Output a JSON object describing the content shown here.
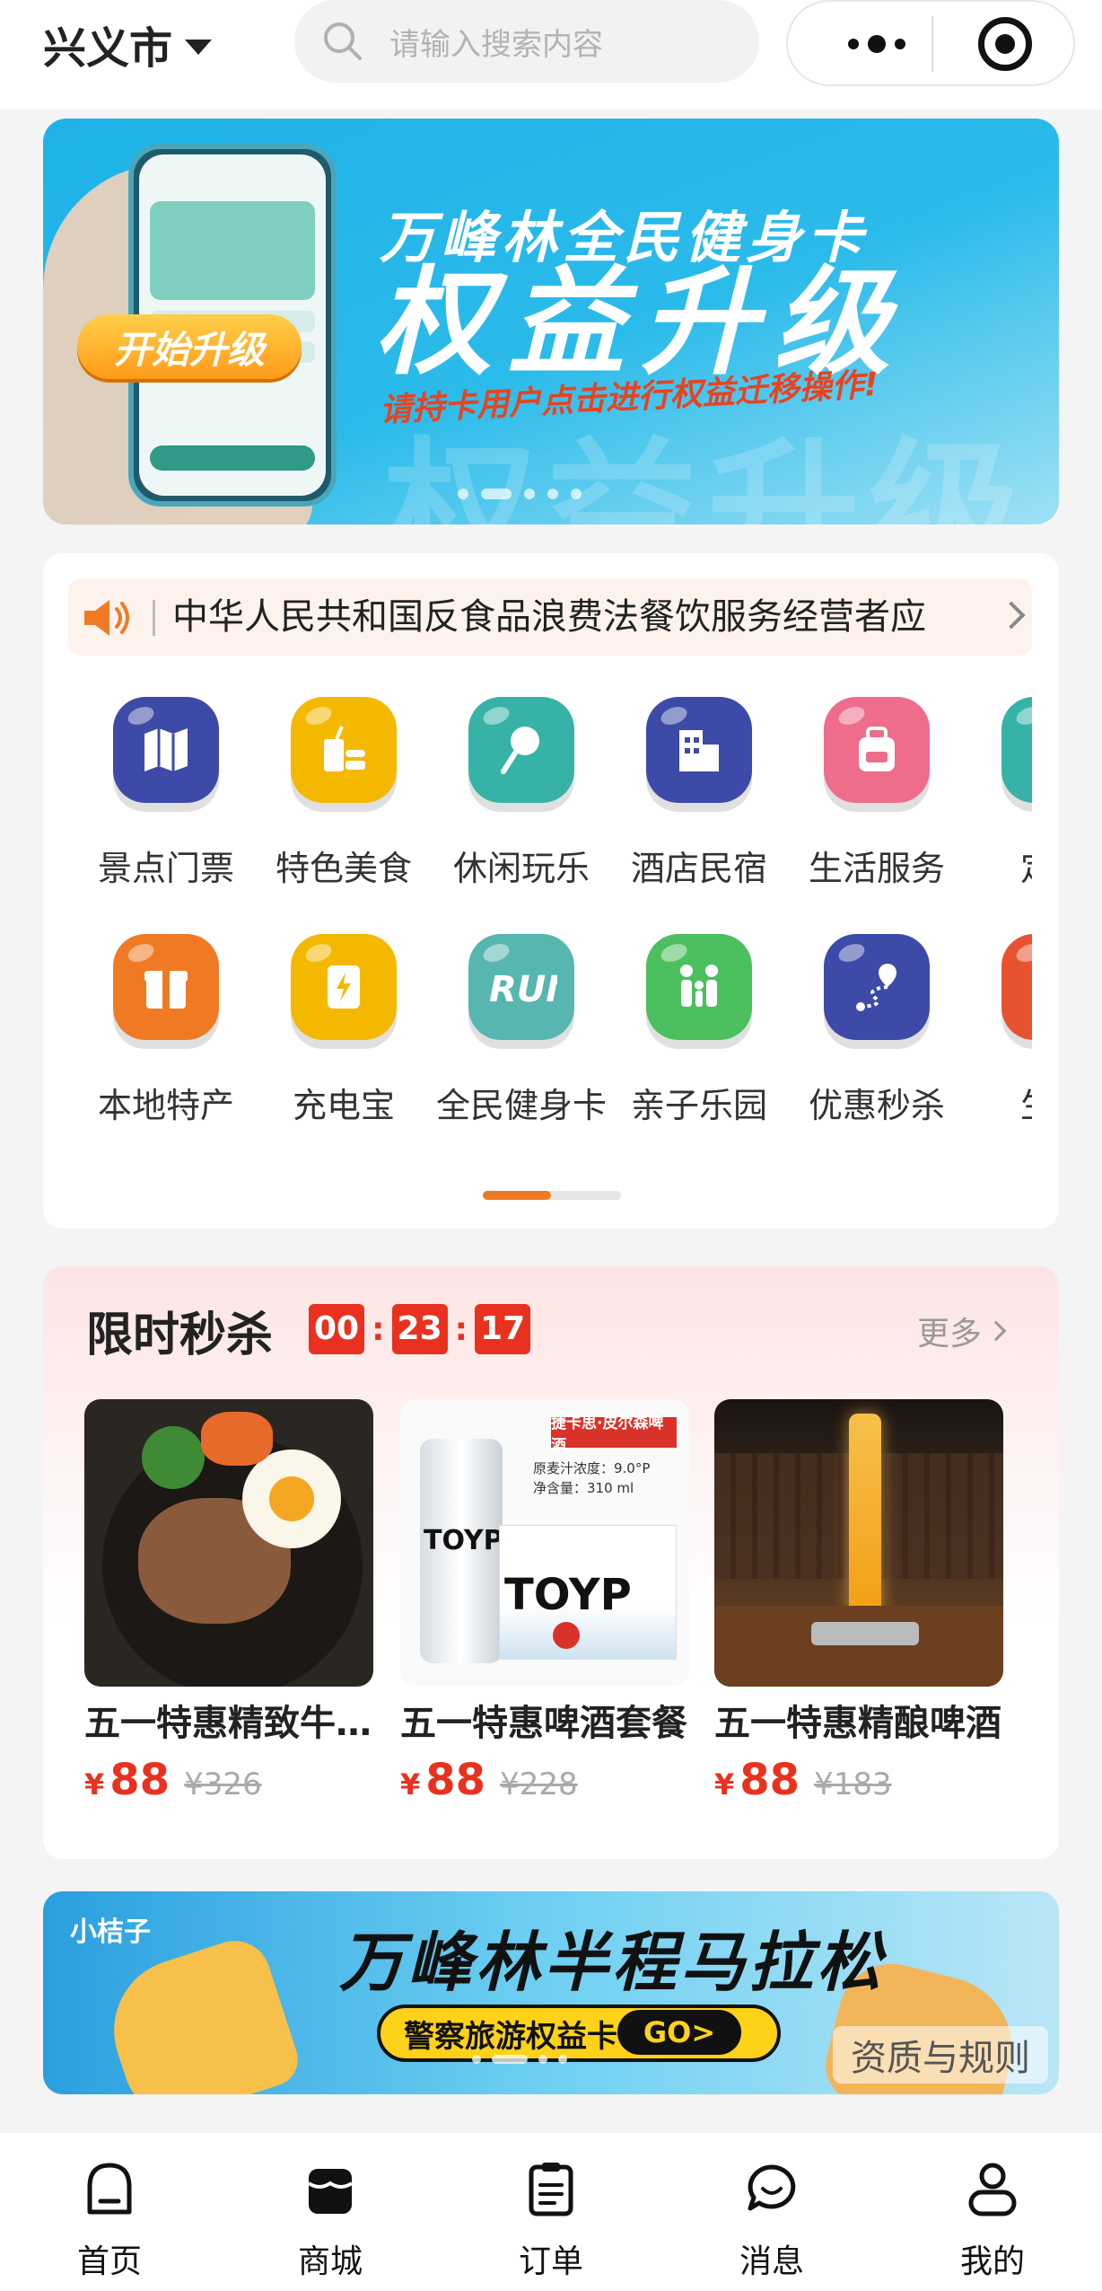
{
  "header": {
    "city": "兴义市",
    "search_placeholder": "请输入搜索内容"
  },
  "banner": {
    "title": "万峰林全民健身卡",
    "headline": "权益升级",
    "subtitle": "请持卡用户点击进行权益迁移操作!",
    "cta": "开始升级",
    "slide_count": 5,
    "active_slide": 2
  },
  "notice": {
    "text": "中华人民共和国反食品浪费法餐饮服务经营者应"
  },
  "categories": [
    {
      "label": "景点门票",
      "icon": "map-icon",
      "color": "#3d4aa8"
    },
    {
      "label": "特色美食",
      "icon": "drink-burger-icon",
      "color": "#f5b800"
    },
    {
      "label": "休闲玩乐",
      "icon": "lollipop-icon",
      "color": "#36b3a6"
    },
    {
      "label": "酒店民宿",
      "icon": "building-icon",
      "color": "#3d4aa8"
    },
    {
      "label": "生活服务",
      "icon": "backpack-icon",
      "color": "#ee6d8a"
    },
    {
      "label": "定制",
      "icon": "service-icon",
      "color": "#36b3a6"
    },
    {
      "label": "本地特产",
      "icon": "gift-box-icon",
      "color": "#f07a24"
    },
    {
      "label": "充电宝",
      "icon": "power-bank-icon",
      "color": "#f5b800"
    },
    {
      "label": "全民健身卡",
      "icon": "run-icon",
      "color": "#58b6b0"
    },
    {
      "label": "亲子乐园",
      "icon": "family-icon",
      "color": "#4cbf5e"
    },
    {
      "label": "优惠秒杀",
      "icon": "route-pin-icon",
      "color": "#3d4aa8"
    },
    {
      "label": "生活",
      "icon": "life-icon",
      "color": "#e8532f"
    }
  ],
  "flash_sale": {
    "title": "限时秒杀",
    "timer": {
      "h": "00",
      "m": "23",
      "s": "17"
    },
    "more_label": "更多",
    "products": [
      {
        "name": "五一特惠精致牛排套餐",
        "currency": "¥",
        "price": "88",
        "old_price": "¥326"
      },
      {
        "name": "五一特惠啤酒套餐",
        "currency": "¥",
        "price": "88",
        "old_price": "¥228"
      },
      {
        "name": "五一特惠精酿啤酒",
        "currency": "¥",
        "price": "88",
        "old_price": "¥183"
      }
    ],
    "beer_label": "捷卡思·皮尔森啤酒",
    "beer_spec1": "原麦汁浓度：9.0°P",
    "beer_spec2": "净含量：310 ml",
    "beer_brand": "TOYP"
  },
  "banner2": {
    "logo": "小桔子",
    "title": "万峰林半程马拉松",
    "pill": "警察旅游权益卡",
    "go": "GO>",
    "rules": "资质与规则"
  },
  "tabbar": [
    {
      "label": "首页",
      "icon": "home-icon"
    },
    {
      "label": "商城",
      "icon": "shop-icon"
    },
    {
      "label": "订单",
      "icon": "order-icon"
    },
    {
      "label": "消息",
      "icon": "message-icon"
    },
    {
      "label": "我的",
      "icon": "profile-icon"
    }
  ]
}
